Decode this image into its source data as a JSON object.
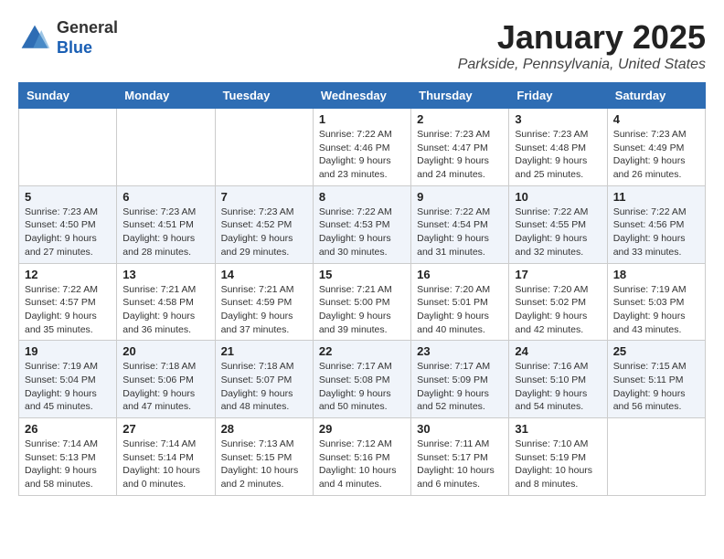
{
  "header": {
    "logo_line1": "General",
    "logo_line2": "Blue",
    "month": "January 2025",
    "location": "Parkside, Pennsylvania, United States"
  },
  "weekdays": [
    "Sunday",
    "Monday",
    "Tuesday",
    "Wednesday",
    "Thursday",
    "Friday",
    "Saturday"
  ],
  "weeks": [
    [
      {
        "day": "",
        "info": ""
      },
      {
        "day": "",
        "info": ""
      },
      {
        "day": "",
        "info": ""
      },
      {
        "day": "1",
        "info": "Sunrise: 7:22 AM\nSunset: 4:46 PM\nDaylight: 9 hours and 23 minutes."
      },
      {
        "day": "2",
        "info": "Sunrise: 7:23 AM\nSunset: 4:47 PM\nDaylight: 9 hours and 24 minutes."
      },
      {
        "day": "3",
        "info": "Sunrise: 7:23 AM\nSunset: 4:48 PM\nDaylight: 9 hours and 25 minutes."
      },
      {
        "day": "4",
        "info": "Sunrise: 7:23 AM\nSunset: 4:49 PM\nDaylight: 9 hours and 26 minutes."
      }
    ],
    [
      {
        "day": "5",
        "info": "Sunrise: 7:23 AM\nSunset: 4:50 PM\nDaylight: 9 hours and 27 minutes."
      },
      {
        "day": "6",
        "info": "Sunrise: 7:23 AM\nSunset: 4:51 PM\nDaylight: 9 hours and 28 minutes."
      },
      {
        "day": "7",
        "info": "Sunrise: 7:23 AM\nSunset: 4:52 PM\nDaylight: 9 hours and 29 minutes."
      },
      {
        "day": "8",
        "info": "Sunrise: 7:22 AM\nSunset: 4:53 PM\nDaylight: 9 hours and 30 minutes."
      },
      {
        "day": "9",
        "info": "Sunrise: 7:22 AM\nSunset: 4:54 PM\nDaylight: 9 hours and 31 minutes."
      },
      {
        "day": "10",
        "info": "Sunrise: 7:22 AM\nSunset: 4:55 PM\nDaylight: 9 hours and 32 minutes."
      },
      {
        "day": "11",
        "info": "Sunrise: 7:22 AM\nSunset: 4:56 PM\nDaylight: 9 hours and 33 minutes."
      }
    ],
    [
      {
        "day": "12",
        "info": "Sunrise: 7:22 AM\nSunset: 4:57 PM\nDaylight: 9 hours and 35 minutes."
      },
      {
        "day": "13",
        "info": "Sunrise: 7:21 AM\nSunset: 4:58 PM\nDaylight: 9 hours and 36 minutes."
      },
      {
        "day": "14",
        "info": "Sunrise: 7:21 AM\nSunset: 4:59 PM\nDaylight: 9 hours and 37 minutes."
      },
      {
        "day": "15",
        "info": "Sunrise: 7:21 AM\nSunset: 5:00 PM\nDaylight: 9 hours and 39 minutes."
      },
      {
        "day": "16",
        "info": "Sunrise: 7:20 AM\nSunset: 5:01 PM\nDaylight: 9 hours and 40 minutes."
      },
      {
        "day": "17",
        "info": "Sunrise: 7:20 AM\nSunset: 5:02 PM\nDaylight: 9 hours and 42 minutes."
      },
      {
        "day": "18",
        "info": "Sunrise: 7:19 AM\nSunset: 5:03 PM\nDaylight: 9 hours and 43 minutes."
      }
    ],
    [
      {
        "day": "19",
        "info": "Sunrise: 7:19 AM\nSunset: 5:04 PM\nDaylight: 9 hours and 45 minutes."
      },
      {
        "day": "20",
        "info": "Sunrise: 7:18 AM\nSunset: 5:06 PM\nDaylight: 9 hours and 47 minutes."
      },
      {
        "day": "21",
        "info": "Sunrise: 7:18 AM\nSunset: 5:07 PM\nDaylight: 9 hours and 48 minutes."
      },
      {
        "day": "22",
        "info": "Sunrise: 7:17 AM\nSunset: 5:08 PM\nDaylight: 9 hours and 50 minutes."
      },
      {
        "day": "23",
        "info": "Sunrise: 7:17 AM\nSunset: 5:09 PM\nDaylight: 9 hours and 52 minutes."
      },
      {
        "day": "24",
        "info": "Sunrise: 7:16 AM\nSunset: 5:10 PM\nDaylight: 9 hours and 54 minutes."
      },
      {
        "day": "25",
        "info": "Sunrise: 7:15 AM\nSunset: 5:11 PM\nDaylight: 9 hours and 56 minutes."
      }
    ],
    [
      {
        "day": "26",
        "info": "Sunrise: 7:14 AM\nSunset: 5:13 PM\nDaylight: 9 hours and 58 minutes."
      },
      {
        "day": "27",
        "info": "Sunrise: 7:14 AM\nSunset: 5:14 PM\nDaylight: 10 hours and 0 minutes."
      },
      {
        "day": "28",
        "info": "Sunrise: 7:13 AM\nSunset: 5:15 PM\nDaylight: 10 hours and 2 minutes."
      },
      {
        "day": "29",
        "info": "Sunrise: 7:12 AM\nSunset: 5:16 PM\nDaylight: 10 hours and 4 minutes."
      },
      {
        "day": "30",
        "info": "Sunrise: 7:11 AM\nSunset: 5:17 PM\nDaylight: 10 hours and 6 minutes."
      },
      {
        "day": "31",
        "info": "Sunrise: 7:10 AM\nSunset: 5:19 PM\nDaylight: 10 hours and 8 minutes."
      },
      {
        "day": "",
        "info": ""
      }
    ]
  ]
}
